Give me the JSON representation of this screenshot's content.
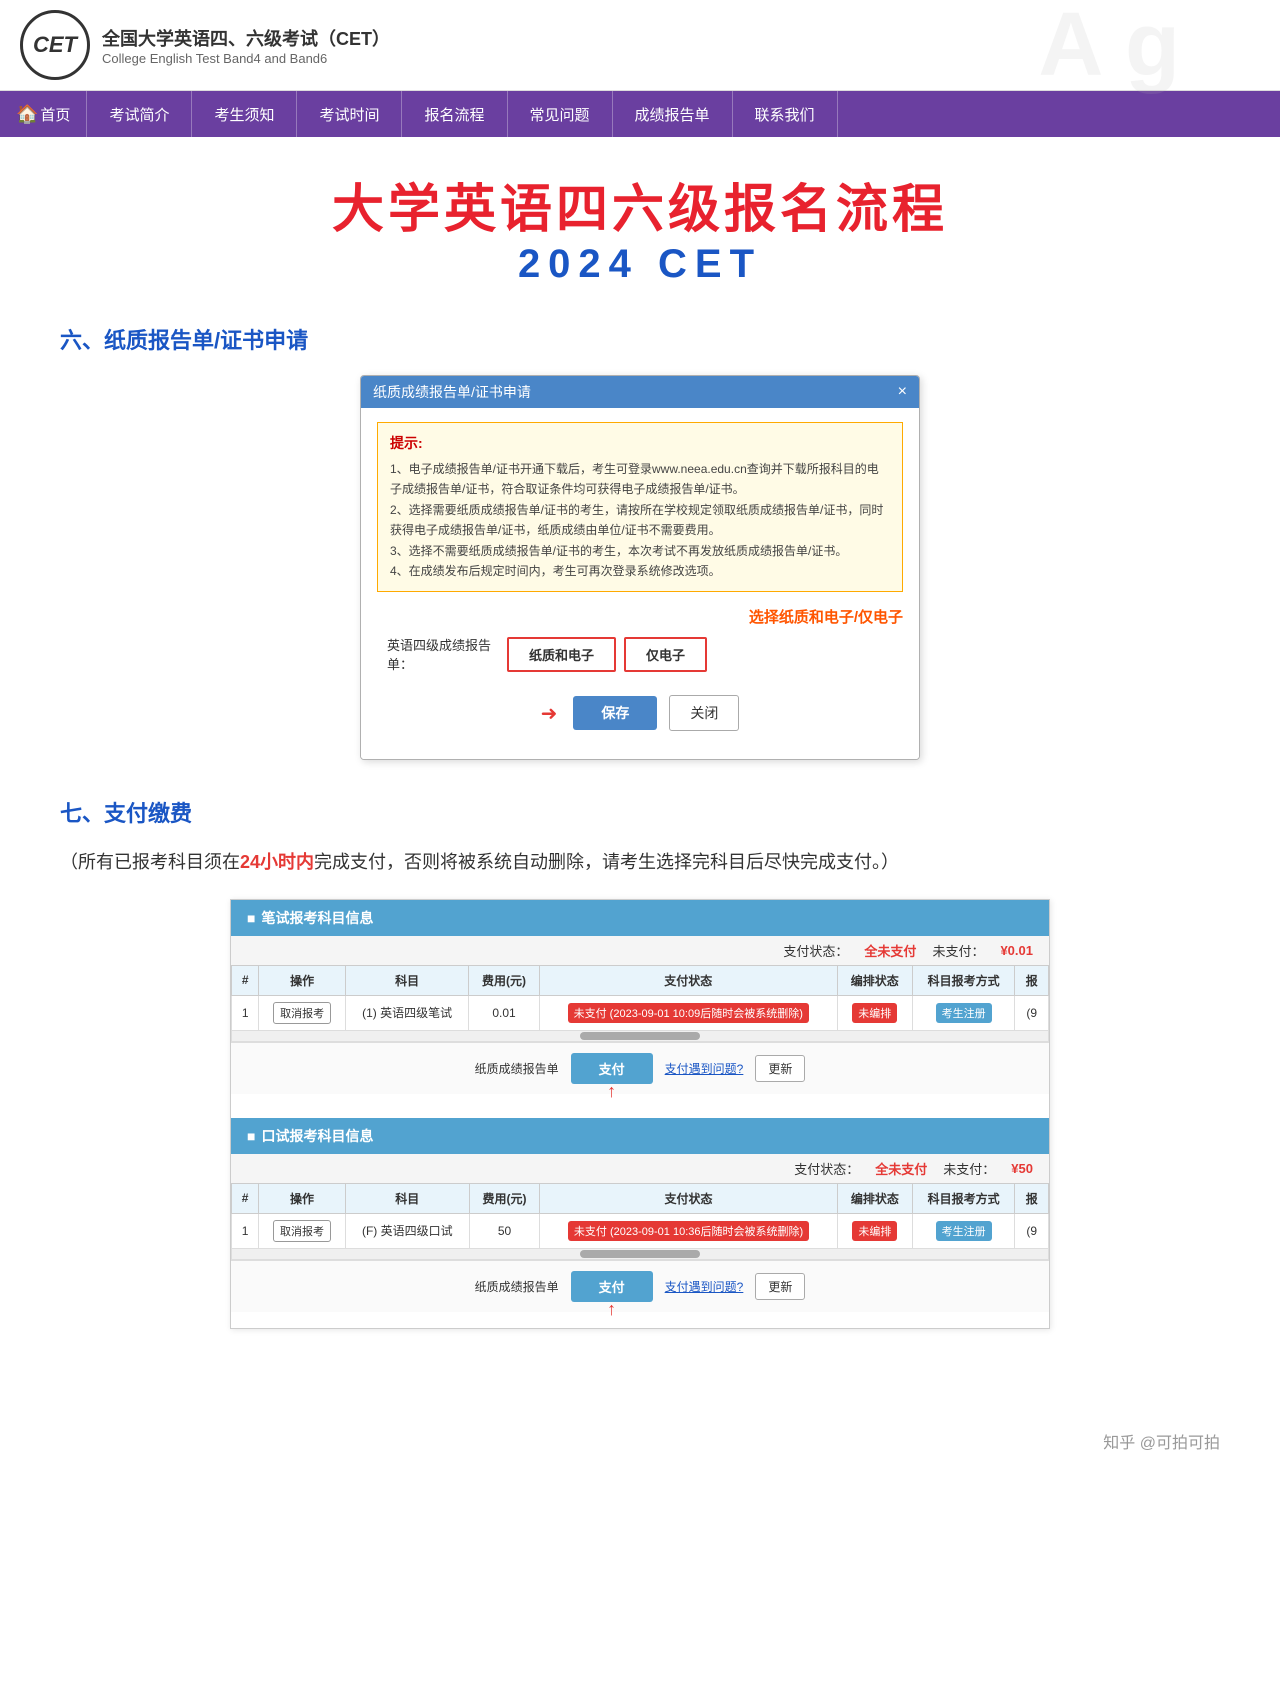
{
  "header": {
    "logo_text": "CET",
    "title_cn": "全国大学英语四、六级考试（CET）",
    "title_en": "College English Test Band4 and Band6",
    "bg_letters": "A g"
  },
  "nav": {
    "items": [
      {
        "id": "home",
        "label": "首页",
        "icon": "🏠"
      },
      {
        "id": "intro",
        "label": "考试简介"
      },
      {
        "id": "notice",
        "label": "考生须知"
      },
      {
        "id": "time",
        "label": "考试时间"
      },
      {
        "id": "process",
        "label": "报名流程"
      },
      {
        "id": "faq",
        "label": "常见问题"
      },
      {
        "id": "report",
        "label": "成绩报告单"
      },
      {
        "id": "contact",
        "label": "联系我们"
      }
    ]
  },
  "page": {
    "title_main": "大学英语四六级报名流程",
    "title_sub": "2024  CET"
  },
  "section6": {
    "heading": "六、纸质报告单/证书申请",
    "dialog": {
      "title": "纸质成绩报告单/证书申请",
      "close": "×",
      "tips_title": "提示:",
      "tips": [
        "1、电子成绩报告单/证书开通下载后，考生可登录www.neea.edu.cn查询并下载所报科目的电子成绩报告单/证书，符合取证条件均可获得电子成绩报告单/证书。",
        "2、选择需要纸质成绩报告单/证书的考生，请按所在学校规定领取纸质成绩报告单/证书，同时获得电子成绩报告单/证书，纸质成绩由单位/证书不需要费用。",
        "3、选择不需要纸质成绩报告单/证书的考生，本次考试不再发放纸质成绩报告单/证书。",
        "4、在成绩发布后规定时间内，考生可再次登录系统修改选项。"
      ],
      "annotation": "选择纸质和电子/仅电子",
      "form_label": "英语四级成绩报告单：",
      "options": [
        "纸质和电子",
        "仅电子"
      ],
      "btn_save": "保存",
      "btn_close": "关闭"
    }
  },
  "section7": {
    "heading": "七、支付缴费",
    "desc": "（所有已报考科目须在",
    "highlight": "24小时内",
    "desc2": "完成支付，否则将被系统自动删除，请考生选择完科目后尽快完成支付。）",
    "written_table": {
      "header": "笔试报考科目信息",
      "pay_status_label": "支付状态：",
      "pay_status_all": "全未支付",
      "pay_unpaid_label": "未支付：",
      "pay_amount": "¥0.01",
      "columns": [
        "#",
        "操作",
        "科目",
        "费用(元)",
        "支付状态",
        "编排状态",
        "科目报考方式",
        "报"
      ],
      "rows": [
        {
          "num": "1",
          "op": "取消报考",
          "subject": "(1) 英语四级笔试",
          "fee": "0.01",
          "pay_status": "未支付 (2023-09-01 10:09后随时会被系统删除)",
          "arrange": "未编排",
          "reg_type": "考生注册",
          "extra": "(9"
        }
      ],
      "action_label": "纸质成绩报告单",
      "btn_pay": "支付",
      "btn_pay_question": "支付遇到问题?",
      "btn_update": "更新"
    },
    "oral_table": {
      "header": "口试报考科目信息",
      "pay_status_label": "支付状态：",
      "pay_status_all": "全未支付",
      "pay_unpaid_label": "未支付：",
      "pay_amount": "¥50",
      "columns": [
        "#",
        "操作",
        "科目",
        "费用(元)",
        "支付状态",
        "编排状态",
        "科目报考方式",
        "报"
      ],
      "rows": [
        {
          "num": "1",
          "op": "取消报考",
          "subject": "(F) 英语四级口试",
          "fee": "50",
          "pay_status": "未支付 (2023-09-01 10:36后随时会被系统删除)",
          "arrange": "未编排",
          "reg_type": "考生注册",
          "extra": "(9"
        }
      ],
      "action_label": "纸质成绩报告单",
      "btn_pay": "支付",
      "btn_pay_question": "支付遇到问题?",
      "btn_update": "更新"
    }
  },
  "footer": {
    "credit": "知乎 @可拍可拍"
  }
}
